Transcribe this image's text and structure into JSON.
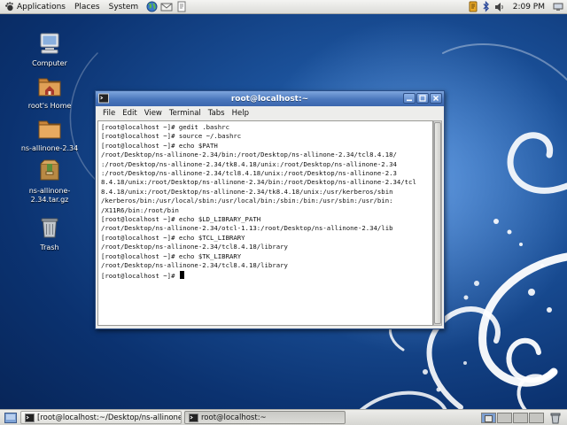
{
  "top_panel": {
    "menus": [
      "Applications",
      "Places",
      "System"
    ],
    "clock": "2:09 PM"
  },
  "desktop_icons": [
    {
      "label": "Computer",
      "icon": "computer-icon"
    },
    {
      "label": "root's Home",
      "icon": "home-folder-icon"
    },
    {
      "label": "ns-allinone-2.34",
      "icon": "folder-icon"
    },
    {
      "label": "ns-allinone-2.34.tar.gz",
      "icon": "archive-icon"
    },
    {
      "label": "Trash",
      "icon": "trash-icon"
    }
  ],
  "terminal": {
    "title": "root@localhost:~",
    "menus": [
      "File",
      "Edit",
      "View",
      "Terminal",
      "Tabs",
      "Help"
    ],
    "lines": [
      "[root@localhost ~]# gedit .bashrc",
      "[root@localhost ~]# source ~/.bashrc",
      "[root@localhost ~]# echo $PATH",
      "/root/Desktop/ns-allinone-2.34/bin:/root/Desktop/ns-allinone-2.34/tcl8.4.18/",
      ":/root/Desktop/ns-allinone-2.34/tk8.4.18/unix:/root/Desktop/ns-allinone-2.34",
      ":/root/Desktop/ns-allinone-2.34/tcl8.4.18/unix:/root/Desktop/ns-allinone-2.3",
      "8.4.18/unix:/root/Desktop/ns-allinone-2.34/bin:/root/Desktop/ns-allinone-2.34/tcl",
      "8.4.18/unix:/root/Desktop/ns-allinone-2.34/tk8.4.18/unix:/usr/kerberos/sbin",
      "/kerberos/bin:/usr/local/sbin:/usr/local/bin:/sbin:/bin:/usr/sbin:/usr/bin:",
      "/X11R6/bin:/root/bin",
      "[root@localhost ~]# echo $LD_LIBRARY_PATH",
      "/root/Desktop/ns-allinone-2.34/otcl-1.13:/root/Desktop/ns-allinone-2.34/lib",
      "[root@localhost ~]# echo $TCL_LIBRARY",
      "/root/Desktop/ns-allinone-2.34/tcl8.4.18/library",
      "[root@localhost ~]# echo $TK_LIBRARY",
      "/root/Desktop/ns-allinone-2.34/tcl8.4.18/library"
    ],
    "prompt": "[root@localhost ~]# "
  },
  "taskbar": {
    "tasks": [
      {
        "label": "[root@localhost:~/Desktop/ns-allinone-..."
      },
      {
        "label": "root@localhost:~"
      }
    ]
  },
  "colors": {
    "titlebar": "#4a77bc",
    "wallpaper": "#1a4f97"
  }
}
